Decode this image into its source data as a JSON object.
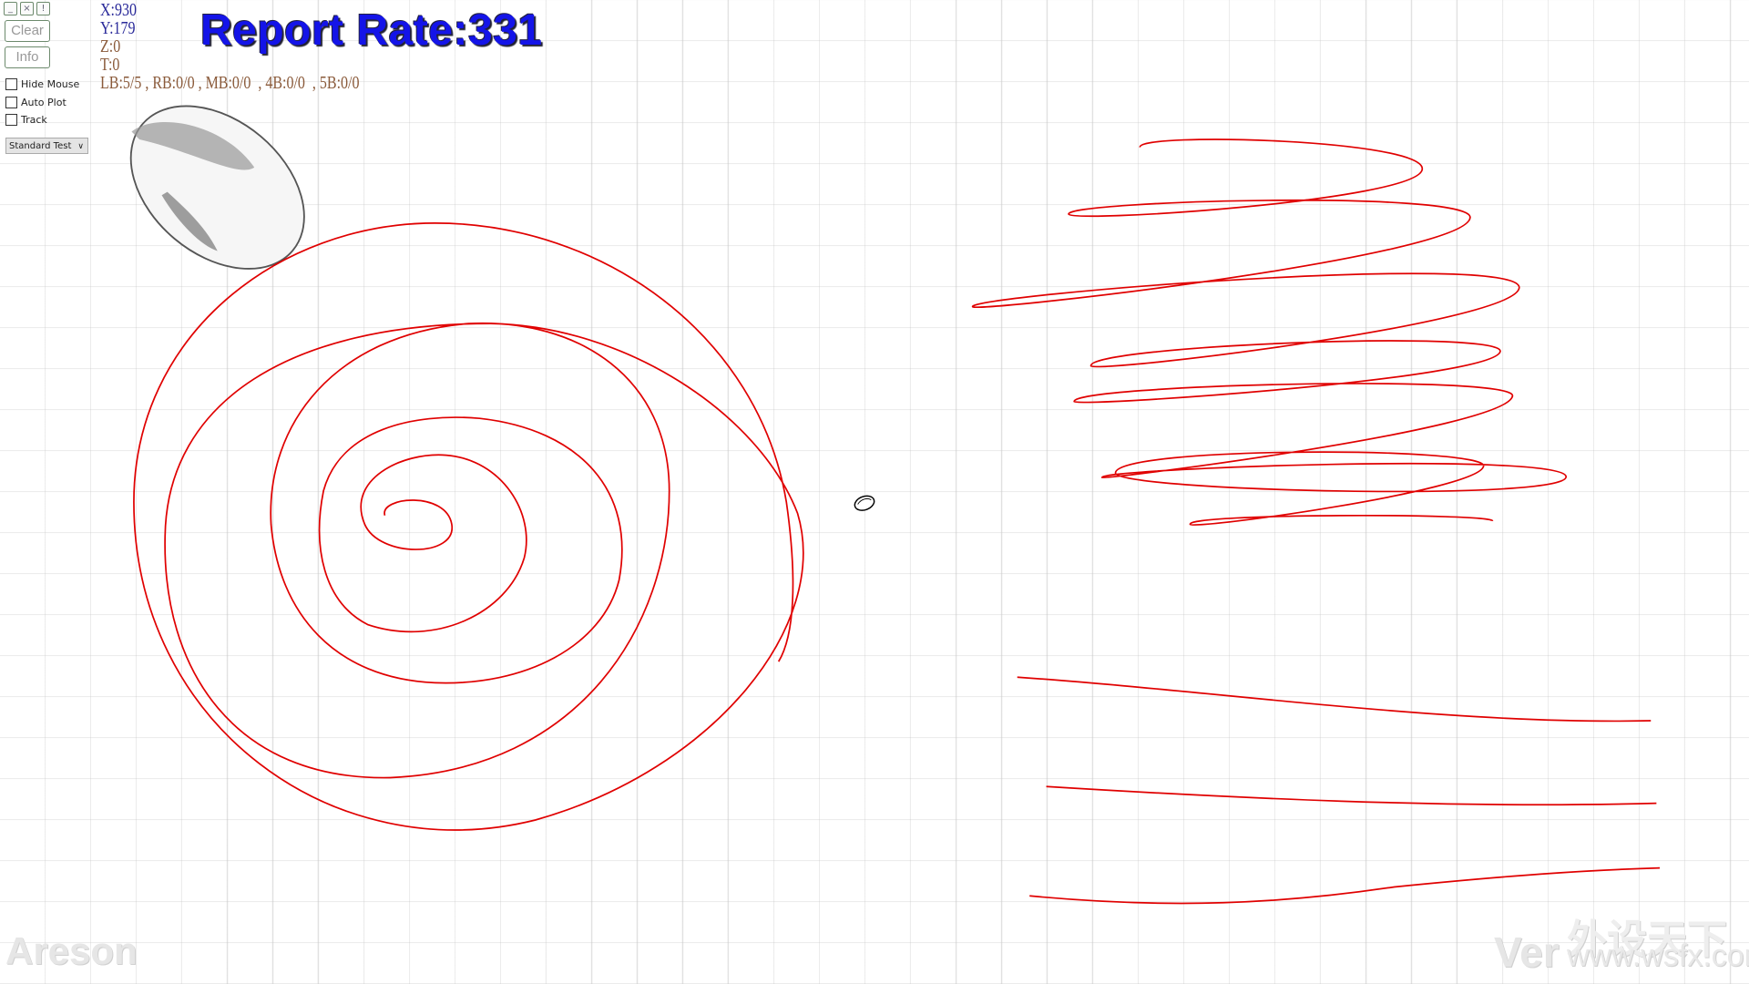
{
  "window_controls": {
    "minimize": "_",
    "close": "×",
    "info": "!"
  },
  "buttons": {
    "clear": "Clear",
    "info": "Info"
  },
  "options": [
    {
      "label": "Hide Mouse",
      "checked": false
    },
    {
      "label": "Auto Plot",
      "checked": false
    },
    {
      "label": "Track",
      "checked": false
    }
  ],
  "mode_select": {
    "value": "Standard Test"
  },
  "readout": {
    "x": "X:930",
    "y": "Y:179",
    "z": "Z:0",
    "t": "T:0",
    "buttons": "LB:5/5 , RB:0/0 , MB:0/0  , 4B:0/0  , 5B:0/0"
  },
  "report_rate": "Report Rate:331",
  "watermarks": {
    "left": "Areson",
    "right": "Ver",
    "site_cn": "外设天下",
    "site_url": "www.wsfx.com"
  },
  "colors": {
    "trace": "#e00000",
    "rate": "#1414e8"
  }
}
